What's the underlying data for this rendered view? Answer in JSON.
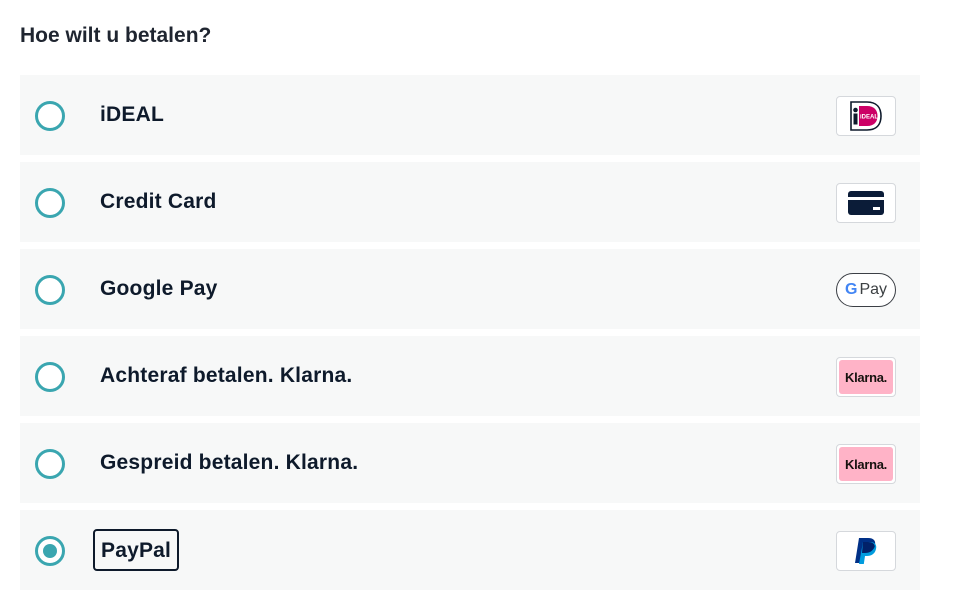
{
  "heading": "Hoe wilt u betalen?",
  "options": [
    {
      "label": "iDEAL",
      "selected": false,
      "icon": "ideal-icon",
      "logo_text": "iDEAL"
    },
    {
      "label": "Credit Card",
      "selected": false,
      "icon": "credit-card-icon"
    },
    {
      "label": "Google Pay",
      "selected": false,
      "icon": "google-pay-icon",
      "logo_text": "Pay"
    },
    {
      "label": "Achteraf betalen. Klarna.",
      "selected": false,
      "icon": "klarna-icon",
      "logo_text": "Klarna."
    },
    {
      "label": "Gespreid betalen. Klarna.",
      "selected": false,
      "icon": "klarna-icon",
      "logo_text": "Klarna."
    },
    {
      "label": "PayPal",
      "selected": true,
      "icon": "paypal-icon"
    }
  ],
  "colors": {
    "radio": "#3aa6b0",
    "row_background": "#f7f8f8",
    "text": "#0e1a2b",
    "ideal_pink": "#cc0066",
    "klarna_pink": "#ffb3c7",
    "paypal_dark": "#003087",
    "paypal_light": "#009cde"
  }
}
